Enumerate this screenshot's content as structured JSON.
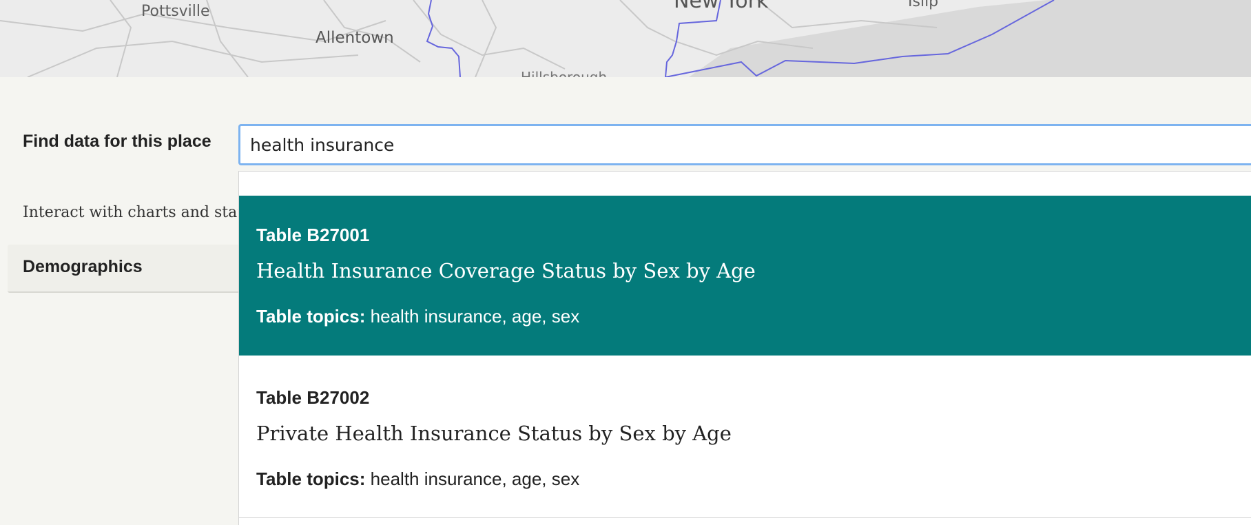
{
  "map": {
    "labels": {
      "pottsville": "Pottsville",
      "allentown": "Allentown",
      "newyork": "New York",
      "islip": "Islip",
      "hillsborough": "Hillsborough"
    }
  },
  "search": {
    "label": "Find data for this place",
    "value": "health insurance"
  },
  "intro_text": "Interact with charts and statistics",
  "section_tab": "Demographics",
  "results": [
    {
      "id": "Table B27001",
      "title": "Health Insurance Coverage Status by Sex by Age",
      "topics_label": "Table topics:",
      "topics": "health insurance, age, sex",
      "highlighted": true
    },
    {
      "id": "Table B27002",
      "title": "Private Health Insurance Status by Sex by Age",
      "topics_label": "Table topics:",
      "topics": "health insurance, age, sex",
      "highlighted": false
    }
  ],
  "colors": {
    "highlight": "#047b7b",
    "input_focus": "#7db3f0",
    "page_bg": "#f5f5f1",
    "map_border": "#6666dd"
  }
}
